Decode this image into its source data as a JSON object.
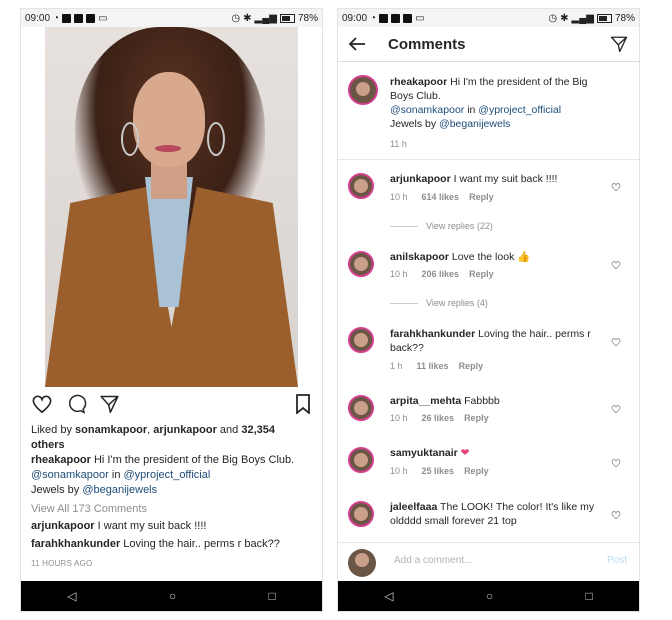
{
  "status": {
    "time": "09:00",
    "battery": "78%"
  },
  "left": {
    "liked_prefix": "Liked by ",
    "liked_user1": "sonamkapoor",
    "liked_sep": ", ",
    "liked_user2": "arjunkapoor",
    "liked_and": " and ",
    "liked_count": "32,354",
    "liked_others": "others",
    "caption_user": "rheakapoor",
    "caption_text": " Hi I'm the president of the Big Boys Club.",
    "caption_tag1": "@sonamkapoor",
    "caption_in": " in ",
    "caption_tag2": "@yproject_official",
    "caption_jewels": "Jewels by ",
    "caption_tag3": "@beganijewels",
    "view_all": "View All 173 Comments",
    "c1_user": "arjunkapoor",
    "c1_text": " I want my suit back !!!!",
    "c2_user": "farahkhankunder",
    "c2_text": " Loving the hair.. perms r back??",
    "timestamp": "11 HOURS AGO"
  },
  "right": {
    "title": "Comments",
    "caption": {
      "user": "rheakapoor",
      "text": " Hi I'm the president of the Big Boys Club.",
      "tag1": "@sonamkapoor",
      "in": " in ",
      "tag2": "@yproject_official",
      "jewels": "Jewels by ",
      "tag3": "@beganijewels",
      "time": "11 h"
    },
    "comments": [
      {
        "user": "arjunkapoor",
        "text": " I want my suit back !!!!",
        "time": "10 h",
        "likes": "614 likes",
        "reply": "Reply",
        "view_replies": "View replies (22)"
      },
      {
        "user": "anilskapoor",
        "text": " Love the look 👍",
        "time": "10 h",
        "likes": "206 likes",
        "reply": "Reply",
        "view_replies": "View replies (4)"
      },
      {
        "user": "farahkhankunder",
        "text": " Loving the hair.. perms r back??",
        "time": "1 h",
        "likes": "11 likes",
        "reply": "Reply"
      },
      {
        "user": "arpita__mehta",
        "text": " Fabbbb",
        "time": "10 h",
        "likes": "26 likes",
        "reply": "Reply"
      },
      {
        "user": "samyuktanair",
        "text": " ❤",
        "time": "10 h",
        "likes": "25 likes",
        "reply": "Reply"
      },
      {
        "user": "jaleelfaaa",
        "text": " The LOOK! The color! It's like my oldddd small forever 21 top",
        "time": "",
        "likes": "",
        "reply": ""
      }
    ],
    "input_placeholder": "Add a comment...",
    "post_label": "Post"
  },
  "colors": {
    "link": "#1e4d7a",
    "muted": "#8e8e8e",
    "story_ring": "#d43f8d",
    "heart_emoji": "#e0457b"
  }
}
